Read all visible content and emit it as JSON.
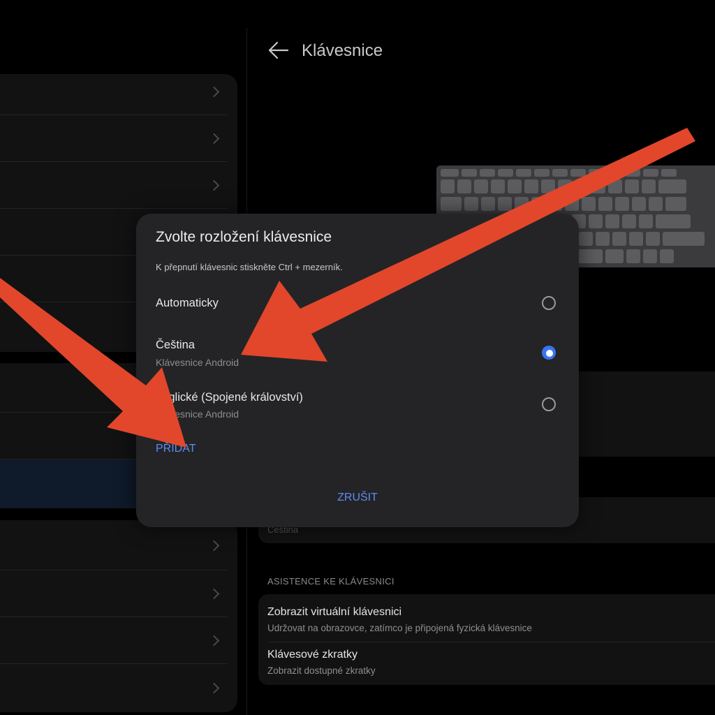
{
  "right_pane": {
    "title": "Klávesnice",
    "faded_value": "Čeština",
    "section_label": "ASISTENCE KE KLÁVESNICI",
    "items": [
      {
        "title": "Zobrazit virtuální klávesnici",
        "subtitle": "Udržovat na obrazovce, zatímco je připojená fyzická klávesnice"
      },
      {
        "title": "Klávesové zkratky",
        "subtitle": "Zobrazit dostupné zkratky"
      }
    ]
  },
  "dialog": {
    "title": "Zvolte rozložení klávesnice",
    "subtitle": "K přepnutí klávesnic stiskněte Ctrl + mezerník.",
    "options": [
      {
        "label": "Automaticky",
        "sub": "",
        "selected": false
      },
      {
        "label": "Čeština",
        "sub": "Klávesnice Android",
        "selected": true
      },
      {
        "label": "anglické (Spojené království)",
        "sub": "Klávesnice Android",
        "selected": false
      }
    ],
    "add_label": "PŘIDAT",
    "cancel_label": "ZRUŠIT"
  },
  "colors": {
    "accent": "#5b8cf5",
    "radio_selected": "#3b74f2",
    "annotation_arrow": "#e2472b"
  },
  "icons": [
    "back-arrow-icon",
    "chevron-right-icon",
    "keyboard-illustration"
  ]
}
